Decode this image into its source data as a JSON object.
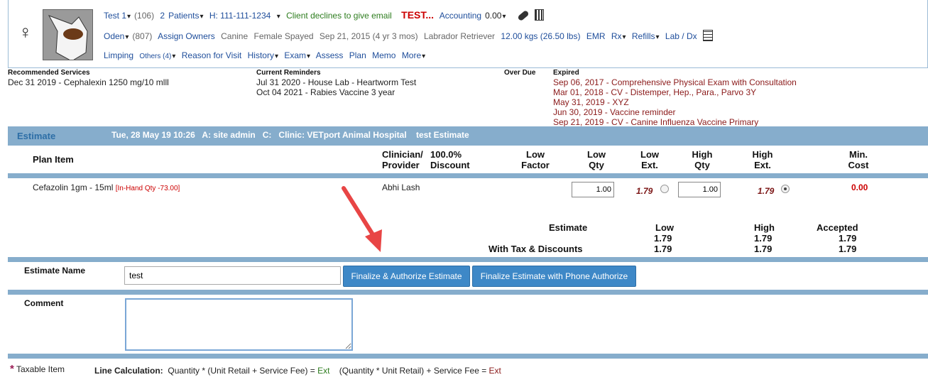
{
  "patient": {
    "row1": {
      "client_name": "Test 1",
      "client_id": "(106)",
      "patients_count": "2",
      "patients_label": "Patients",
      "phone": "H: 111-111-1234",
      "email_status": "Client declines to give email",
      "alert": "TEST...",
      "accounting_label": "Accounting",
      "accounting_value": "0.00"
    },
    "row2": {
      "pet_name": "Oden",
      "pet_id": "(807)",
      "assign_owners": "Assign Owners",
      "species": "Canine",
      "sex": "Female Spayed",
      "dob": "Sep 21, 2015 (4 yr 3 mos)",
      "breed": "Labrador Retriever",
      "weight": "12.00 kgs (26.50 lbs)",
      "emr": "EMR",
      "rx": "Rx",
      "refills": "Refills",
      "lab": "Lab / Dx"
    },
    "row3": {
      "complaint": "Limping",
      "others": "Others (4)",
      "reason": "Reason for Visit",
      "history": "History",
      "exam": "Exam",
      "assess": "Assess",
      "plan": "Plan",
      "memo": "Memo",
      "more": "More"
    }
  },
  "reminders": {
    "recommended_title": "Recommended Services",
    "recommended": [
      "Dec 31 2019 - Cephalexin 1250 mg/10 mlll"
    ],
    "current_title": "Current Reminders",
    "current": [
      "Jul 31 2020 - House Lab - Heartworm Test",
      "Oct 04 2021 - Rabies Vaccine 3 year"
    ],
    "overdue_title": "Over Due",
    "expired_title": "Expired",
    "expired": [
      "Sep 06, 2017 - Comprehensive Physical Exam with Consultation",
      "Mar 01, 2018 - CV - Distemper, Hep., Para., Parvo 3Y",
      "May 31, 2019 - XYZ",
      "Jun 30, 2019 - Vaccine reminder",
      "Sep 21, 2019 - CV - Canine Influenza Vaccine Primary"
    ]
  },
  "estimate": {
    "tab": "Estimate",
    "info": "Tue, 28 May 19 10:26   A: site admin   C:   Clinic: VETport Animal Hospital    test Estimate",
    "columns": {
      "plan_item": "Plan Item",
      "clinician_1": "Clinician/",
      "clinician_2": "Provider",
      "discount_1": "100.0%",
      "discount_2": "Discount",
      "low_factor_1": "Low",
      "low_factor_2": "Factor",
      "low_qty_1": "Low",
      "low_qty_2": "Qty",
      "low_ext_1": "Low",
      "low_ext_2": "Ext.",
      "high_qty_1": "High",
      "high_qty_2": "Qty",
      "high_ext_1": "High",
      "high_ext_2": "Ext.",
      "min_cost_1": "Min.",
      "min_cost_2": "Cost"
    },
    "item": {
      "name": "Cefazolin 1gm - 15ml",
      "in_hand": "[In-Hand Qty -73.00]",
      "clinician": "Abhi Lash",
      "low_qty": "1.00",
      "low_ext": "1.79",
      "high_qty": "1.00",
      "high_ext": "1.79",
      "min_cost": "0.00"
    },
    "totals": {
      "estimate_label": "Estimate",
      "tax_label": "With Tax & Discounts",
      "low_label": "Low",
      "high_label": "High",
      "accepted_label": "Accepted",
      "low_est": "1.79",
      "high_est": "1.79",
      "accepted_est": "1.79",
      "low_tax": "1.79",
      "high_tax": "1.79",
      "accepted_tax": "1.79"
    },
    "name_label": "Estimate Name",
    "name_value": "test",
    "btn_finalize": "Finalize & Authorize Estimate",
    "btn_phone": "Finalize Estimate with Phone Authorize",
    "comment_label": "Comment",
    "comment_value": ""
  },
  "footer": {
    "asterisk": "*",
    "taxable": "Taxable Item",
    "line_calc_label": "Line Calculation:",
    "formula1": "Quantity * (Unit Retail + Service Fee) = ",
    "ext1": "Ext",
    "formula2": "(Quantity * Unit Retail) + Service Fee = ",
    "ext2": "Ext"
  },
  "colors": {
    "bar": "#86adcc",
    "accent": "#3e88c7",
    "alert": "#cc0000",
    "expired": "#8b1a1a",
    "email": "#2e7d1f"
  }
}
